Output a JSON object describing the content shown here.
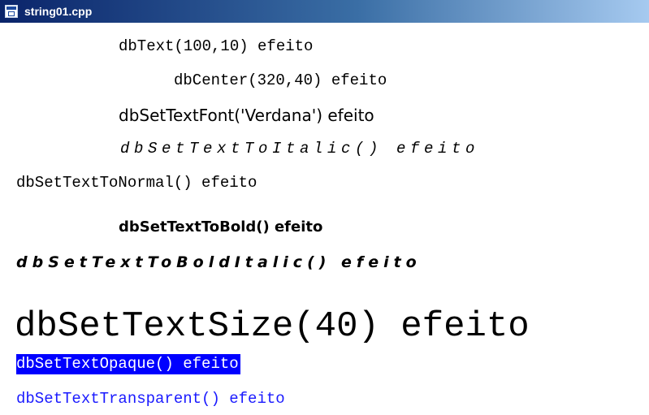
{
  "window": {
    "title": "string01.cpp",
    "icon": "application-window-icon"
  },
  "colors": {
    "highlight_bg": "#0000ff",
    "highlight_fg": "#ffffff",
    "blue_text": "#1a1aff",
    "text": "#000000"
  },
  "lines": [
    {
      "text": "dbText(100,10) efeito"
    },
    {
      "text": "dbCenter(320,40) efeito"
    },
    {
      "text": "dbSetTextFont('Verdana') efeito"
    },
    {
      "text": "dbSetTextToItalic() efeito"
    },
    {
      "text": "dbSetTextToNormal() efeito"
    },
    {
      "text": "dbSetTextToBold() efeito"
    },
    {
      "text": "dbSetTextToBoldItalic() efeito"
    },
    {
      "text": "dbSetTextSize(40) efeito"
    },
    {
      "text": "dbSetTextOpaque() efeito"
    },
    {
      "text": "dbSetTextTransparent() efeito"
    }
  ]
}
